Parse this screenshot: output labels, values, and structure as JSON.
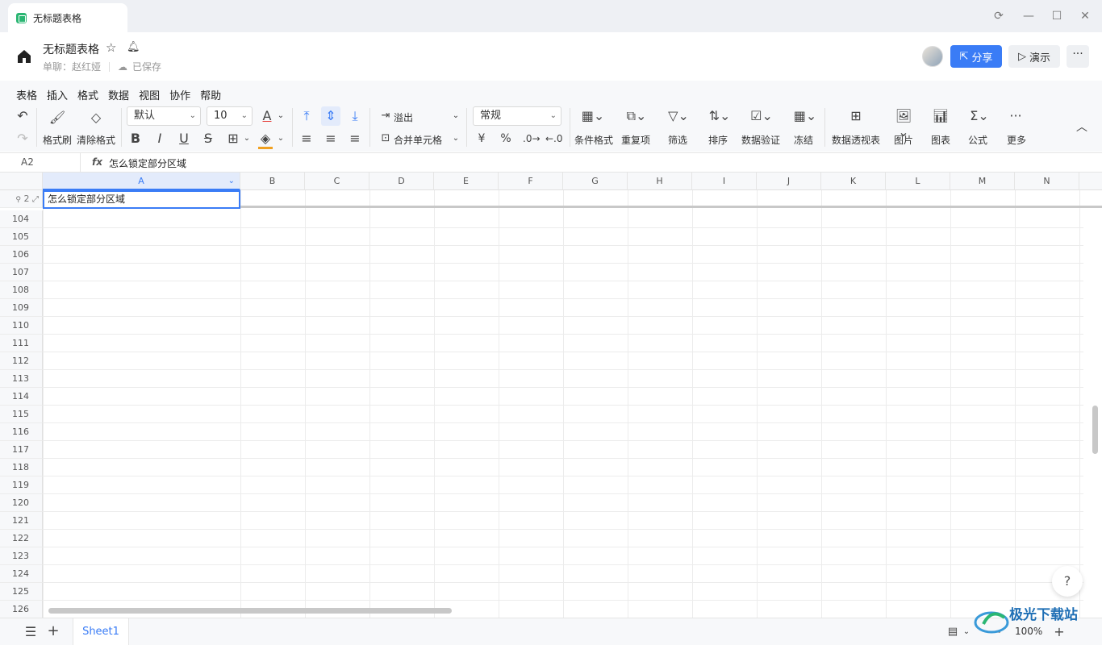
{
  "window": {
    "tab_title": "无标题表格",
    "controls": [
      "sync-icon",
      "minimize-icon",
      "maximize-icon",
      "close-icon"
    ]
  },
  "doc": {
    "title": "无标题表格",
    "chat_label": "单聊：赵红娅",
    "save_status": "已保存",
    "share_label": "分享",
    "present_label": "演示",
    "more_label": "···"
  },
  "menu": [
    "表格",
    "插入",
    "格式",
    "数据",
    "视图",
    "协作",
    "帮助"
  ],
  "toolbar": {
    "format_painter": "格式刷",
    "clear_format": "清除格式",
    "font": "默认",
    "font_size": "10",
    "overflow": "溢出",
    "merge": "合并单元格",
    "number_format": "常规",
    "currency": "¥",
    "percent": "%",
    "cond_format": "条件格式",
    "dup": "重复项",
    "filter": "筛选",
    "sort": "排序",
    "validation": "数据验证",
    "freeze": "冻结",
    "pivot": "数据透视表",
    "image": "图片",
    "chart": "图表",
    "formula": "公式",
    "more": "更多",
    "bold": "B",
    "italic": "I",
    "underline": "U",
    "strike": "S"
  },
  "formula_bar": {
    "cell_ref": "A2",
    "fx": "fx",
    "value": "怎么锁定部分区域"
  },
  "columns": [
    "A",
    "B",
    "C",
    "D",
    "E",
    "F",
    "G",
    "H",
    "I",
    "J",
    "K",
    "L",
    "M",
    "N"
  ],
  "frozen_row": {
    "num": "2",
    "value": "怎么锁定部分区域"
  },
  "rows": [
    "104",
    "105",
    "106",
    "107",
    "108",
    "109",
    "110",
    "111",
    "112",
    "113",
    "114",
    "115",
    "116",
    "117",
    "118",
    "119",
    "120",
    "121",
    "122",
    "123",
    "124",
    "125",
    "126"
  ],
  "sheet": {
    "name": "Sheet1",
    "zoom": "100%"
  },
  "watermark": "极光下载站",
  "colors": {
    "accent": "#3a7cf6",
    "sheet_icon": "#2bb673"
  }
}
